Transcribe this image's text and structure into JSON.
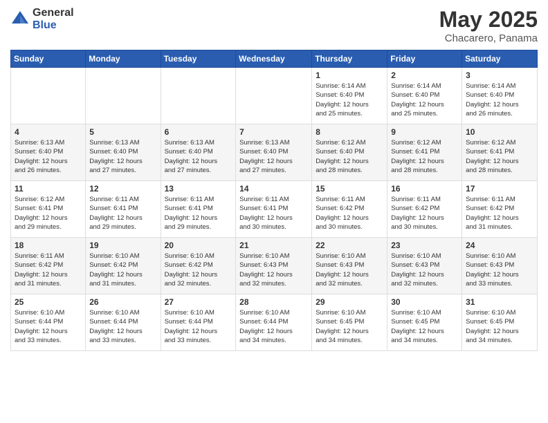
{
  "logo": {
    "general": "General",
    "blue": "Blue"
  },
  "title": "May 2025",
  "location": "Chacarero, Panama",
  "weekdays": [
    "Sunday",
    "Monday",
    "Tuesday",
    "Wednesday",
    "Thursday",
    "Friday",
    "Saturday"
  ],
  "weeks": [
    [
      {
        "day": "",
        "info": ""
      },
      {
        "day": "",
        "info": ""
      },
      {
        "day": "",
        "info": ""
      },
      {
        "day": "",
        "info": ""
      },
      {
        "day": "1",
        "info": "Sunrise: 6:14 AM\nSunset: 6:40 PM\nDaylight: 12 hours\nand 25 minutes."
      },
      {
        "day": "2",
        "info": "Sunrise: 6:14 AM\nSunset: 6:40 PM\nDaylight: 12 hours\nand 25 minutes."
      },
      {
        "day": "3",
        "info": "Sunrise: 6:14 AM\nSunset: 6:40 PM\nDaylight: 12 hours\nand 26 minutes."
      }
    ],
    [
      {
        "day": "4",
        "info": "Sunrise: 6:13 AM\nSunset: 6:40 PM\nDaylight: 12 hours\nand 26 minutes."
      },
      {
        "day": "5",
        "info": "Sunrise: 6:13 AM\nSunset: 6:40 PM\nDaylight: 12 hours\nand 27 minutes."
      },
      {
        "day": "6",
        "info": "Sunrise: 6:13 AM\nSunset: 6:40 PM\nDaylight: 12 hours\nand 27 minutes."
      },
      {
        "day": "7",
        "info": "Sunrise: 6:13 AM\nSunset: 6:40 PM\nDaylight: 12 hours\nand 27 minutes."
      },
      {
        "day": "8",
        "info": "Sunrise: 6:12 AM\nSunset: 6:40 PM\nDaylight: 12 hours\nand 28 minutes."
      },
      {
        "day": "9",
        "info": "Sunrise: 6:12 AM\nSunset: 6:41 PM\nDaylight: 12 hours\nand 28 minutes."
      },
      {
        "day": "10",
        "info": "Sunrise: 6:12 AM\nSunset: 6:41 PM\nDaylight: 12 hours\nand 28 minutes."
      }
    ],
    [
      {
        "day": "11",
        "info": "Sunrise: 6:12 AM\nSunset: 6:41 PM\nDaylight: 12 hours\nand 29 minutes."
      },
      {
        "day": "12",
        "info": "Sunrise: 6:11 AM\nSunset: 6:41 PM\nDaylight: 12 hours\nand 29 minutes."
      },
      {
        "day": "13",
        "info": "Sunrise: 6:11 AM\nSunset: 6:41 PM\nDaylight: 12 hours\nand 29 minutes."
      },
      {
        "day": "14",
        "info": "Sunrise: 6:11 AM\nSunset: 6:41 PM\nDaylight: 12 hours\nand 30 minutes."
      },
      {
        "day": "15",
        "info": "Sunrise: 6:11 AM\nSunset: 6:42 PM\nDaylight: 12 hours\nand 30 minutes."
      },
      {
        "day": "16",
        "info": "Sunrise: 6:11 AM\nSunset: 6:42 PM\nDaylight: 12 hours\nand 30 minutes."
      },
      {
        "day": "17",
        "info": "Sunrise: 6:11 AM\nSunset: 6:42 PM\nDaylight: 12 hours\nand 31 minutes."
      }
    ],
    [
      {
        "day": "18",
        "info": "Sunrise: 6:11 AM\nSunset: 6:42 PM\nDaylight: 12 hours\nand 31 minutes."
      },
      {
        "day": "19",
        "info": "Sunrise: 6:10 AM\nSunset: 6:42 PM\nDaylight: 12 hours\nand 31 minutes."
      },
      {
        "day": "20",
        "info": "Sunrise: 6:10 AM\nSunset: 6:42 PM\nDaylight: 12 hours\nand 32 minutes."
      },
      {
        "day": "21",
        "info": "Sunrise: 6:10 AM\nSunset: 6:43 PM\nDaylight: 12 hours\nand 32 minutes."
      },
      {
        "day": "22",
        "info": "Sunrise: 6:10 AM\nSunset: 6:43 PM\nDaylight: 12 hours\nand 32 minutes."
      },
      {
        "day": "23",
        "info": "Sunrise: 6:10 AM\nSunset: 6:43 PM\nDaylight: 12 hours\nand 32 minutes."
      },
      {
        "day": "24",
        "info": "Sunrise: 6:10 AM\nSunset: 6:43 PM\nDaylight: 12 hours\nand 33 minutes."
      }
    ],
    [
      {
        "day": "25",
        "info": "Sunrise: 6:10 AM\nSunset: 6:44 PM\nDaylight: 12 hours\nand 33 minutes."
      },
      {
        "day": "26",
        "info": "Sunrise: 6:10 AM\nSunset: 6:44 PM\nDaylight: 12 hours\nand 33 minutes."
      },
      {
        "day": "27",
        "info": "Sunrise: 6:10 AM\nSunset: 6:44 PM\nDaylight: 12 hours\nand 33 minutes."
      },
      {
        "day": "28",
        "info": "Sunrise: 6:10 AM\nSunset: 6:44 PM\nDaylight: 12 hours\nand 34 minutes."
      },
      {
        "day": "29",
        "info": "Sunrise: 6:10 AM\nSunset: 6:45 PM\nDaylight: 12 hours\nand 34 minutes."
      },
      {
        "day": "30",
        "info": "Sunrise: 6:10 AM\nSunset: 6:45 PM\nDaylight: 12 hours\nand 34 minutes."
      },
      {
        "day": "31",
        "info": "Sunrise: 6:10 AM\nSunset: 6:45 PM\nDaylight: 12 hours\nand 34 minutes."
      }
    ]
  ]
}
